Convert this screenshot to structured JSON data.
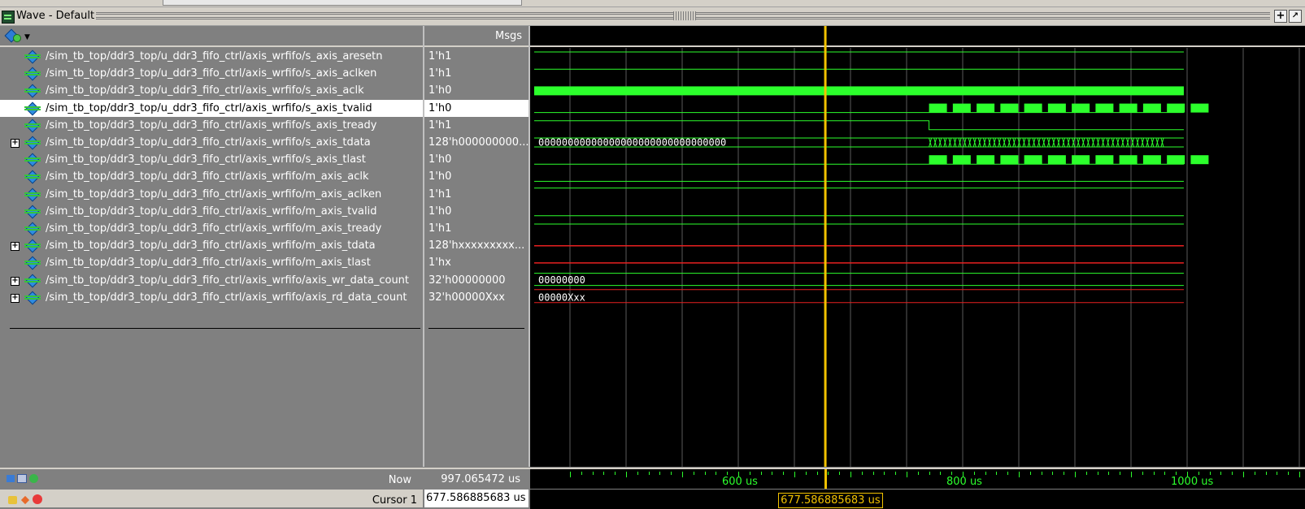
{
  "window": {
    "title": "Wave - Default",
    "btn_add": "+",
    "btn_undock": "↗"
  },
  "header": {
    "msgs_label": "Msgs"
  },
  "signals": [
    {
      "name": "/sim_tb_top/ddr3_top/u_ddr3_fifo_ctrl/axis_wrfifo/s_axis_aresetn",
      "value": "1'h1",
      "expandable": false,
      "selected": false
    },
    {
      "name": "/sim_tb_top/ddr3_top/u_ddr3_fifo_ctrl/axis_wrfifo/s_axis_aclken",
      "value": "1'h1",
      "expandable": false,
      "selected": false
    },
    {
      "name": "/sim_tb_top/ddr3_top/u_ddr3_fifo_ctrl/axis_wrfifo/s_axis_aclk",
      "value": "1'h0",
      "expandable": false,
      "selected": false
    },
    {
      "name": "/sim_tb_top/ddr3_top/u_ddr3_fifo_ctrl/axis_wrfifo/s_axis_tvalid",
      "value": "1'h0",
      "expandable": false,
      "selected": true
    },
    {
      "name": "/sim_tb_top/ddr3_top/u_ddr3_fifo_ctrl/axis_wrfifo/s_axis_tready",
      "value": "1'h1",
      "expandable": false,
      "selected": false
    },
    {
      "name": "/sim_tb_top/ddr3_top/u_ddr3_fifo_ctrl/axis_wrfifo/s_axis_tdata",
      "value": "128'h000000000...",
      "expandable": true,
      "selected": false
    },
    {
      "name": "/sim_tb_top/ddr3_top/u_ddr3_fifo_ctrl/axis_wrfifo/s_axis_tlast",
      "value": "1'h0",
      "expandable": false,
      "selected": false
    },
    {
      "name": "/sim_tb_top/ddr3_top/u_ddr3_fifo_ctrl/axis_wrfifo/m_axis_aclk",
      "value": "1'h0",
      "expandable": false,
      "selected": false
    },
    {
      "name": "/sim_tb_top/ddr3_top/u_ddr3_fifo_ctrl/axis_wrfifo/m_axis_aclken",
      "value": "1'h1",
      "expandable": false,
      "selected": false
    },
    {
      "name": "/sim_tb_top/ddr3_top/u_ddr3_fifo_ctrl/axis_wrfifo/m_axis_tvalid",
      "value": "1'h0",
      "expandable": false,
      "selected": false
    },
    {
      "name": "/sim_tb_top/ddr3_top/u_ddr3_fifo_ctrl/axis_wrfifo/m_axis_tready",
      "value": "1'h1",
      "expandable": false,
      "selected": false
    },
    {
      "name": "/sim_tb_top/ddr3_top/u_ddr3_fifo_ctrl/axis_wrfifo/m_axis_tdata",
      "value": "128'hxxxxxxxxx...",
      "expandable": true,
      "selected": false
    },
    {
      "name": "/sim_tb_top/ddr3_top/u_ddr3_fifo_ctrl/axis_wrfifo/m_axis_tlast",
      "value": "1'hx",
      "expandable": false,
      "selected": false
    },
    {
      "name": "/sim_tb_top/ddr3_top/u_ddr3_fifo_ctrl/axis_wrfifo/axis_wr_data_count",
      "value": "32'h00000000",
      "expandable": true,
      "selected": false
    },
    {
      "name": "/sim_tb_top/ddr3_top/u_ddr3_fifo_ctrl/axis_wrfifo/axis_rd_data_count",
      "value": "32'h00000Xxx",
      "expandable": true,
      "selected": false
    }
  ],
  "wave_labels": {
    "tdata_value": "00000000000000000000000000000000",
    "wr_count_value": "00000000",
    "rd_count_value": "00000Xxx"
  },
  "colors": {
    "wave_green": "#2cff2c",
    "wave_red": "#e82020",
    "cursor": "#f2c200",
    "grid": "#5a5a5a"
  },
  "timeline": {
    "labels": [
      {
        "text": "600 us",
        "time": 600
      },
      {
        "text": "800 us",
        "time": 800
      },
      {
        "text": "1000 us",
        "time": 1000
      }
    ]
  },
  "status": {
    "now_label": "Now",
    "now_value": "997.065472 us",
    "cursor_label": "Cursor 1",
    "cursor_value": "677.586885683 us",
    "cursor_box": "677.586885683 us"
  }
}
